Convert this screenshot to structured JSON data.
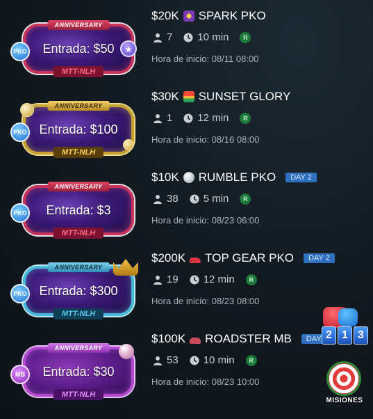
{
  "colors": {
    "background": "#121a21",
    "day_badge": "#2f6fbf",
    "r_badge": "#1e7a3b"
  },
  "tournaments": [
    {
      "prize": "$20K",
      "icon": "spark-icon",
      "name": "SPARK PKO",
      "ribbon": "ANNIVERSARY",
      "entry": "Entrada: $50",
      "format": "MTT-NLH",
      "type_tag": "PKO",
      "players": "7",
      "duration": "10 min",
      "r_label": "R",
      "start": "Hora de inicio: 08/11 08:00",
      "day": ""
    },
    {
      "prize": "$30K",
      "icon": "sunset-icon",
      "name": "SUNSET GLORY",
      "ribbon": "ANNIVERSARY",
      "entry": "Entrada: $100",
      "format": "MTT-NLH",
      "type_tag": "PKO",
      "players": "1",
      "duration": "12 min",
      "r_label": "R",
      "start": "Hora de inicio: 08/16 08:00",
      "day": ""
    },
    {
      "prize": "$10K",
      "icon": "ball-icon",
      "name": "RUMBLE PKO",
      "ribbon": "ANNIVERSARY",
      "entry": "Entrada: $3",
      "format": "MTT-NLH",
      "type_tag": "PKO",
      "players": "38",
      "duration": "5 min",
      "r_label": "R",
      "start": "Hora de inicio: 08/23 06:00",
      "day": "DAY 2"
    },
    {
      "prize": "$200K",
      "icon": "race-car-icon",
      "name": "TOP GEAR PKO",
      "ribbon": "ANNIVERSARY",
      "entry": "Entrada: $300",
      "format": "MTT-NLH",
      "type_tag": "PKO",
      "players": "19",
      "duration": "12 min",
      "r_label": "R",
      "start": "Hora de inicio: 08/23 08:00",
      "day": "DAY 2"
    },
    {
      "prize": "$100K",
      "icon": "car-icon",
      "name": "ROADSTER MB",
      "ribbon": "ANNIVERSARY",
      "entry": "Entrada: $30",
      "format": "MTT-NLH",
      "type_tag": "MB",
      "players": "53",
      "duration": "10 min",
      "r_label": "R",
      "start": "Hora de inicio: 08/23 10:00",
      "day": "DAY 2"
    }
  ],
  "side_widgets": {
    "counter_digits": [
      "2",
      "1",
      "3"
    ],
    "missions_label": "MISIONES"
  }
}
